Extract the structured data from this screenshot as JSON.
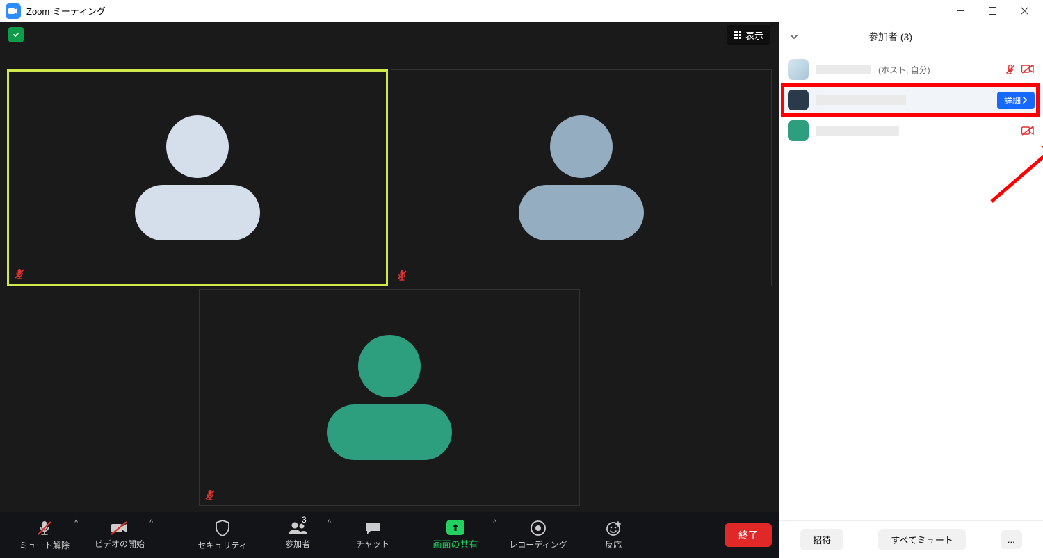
{
  "title_bar": {
    "title": "Zoom ミーティング"
  },
  "video_area": {
    "view_button": "表示",
    "tiles": [
      {
        "avatar_color": "#d5deeb",
        "muted": true,
        "highlighted": true
      },
      {
        "avatar_color": "#94adc1",
        "muted": true,
        "highlighted": false
      },
      {
        "avatar_color": "#2d9f7f",
        "muted": true,
        "highlighted": false
      }
    ]
  },
  "toolbar": {
    "mute": "ミュート解除",
    "video": "ビデオの開始",
    "security": "セキュリティ",
    "participants": "参加者",
    "participants_count": "3",
    "chat": "チャット",
    "share": "画面の共有",
    "record": "レコーディング",
    "reactions": "反応",
    "end": "終了"
  },
  "side": {
    "title": "参加者 (3)",
    "rows": [
      {
        "avatar_bg": "linear-gradient(135deg,#d8e8f0,#a8c4d8)",
        "role": "(ホスト, 自分)",
        "muted": true,
        "cam_off": true
      },
      {
        "avatar_bg": "#2a3a4a",
        "role": "",
        "hovered": true,
        "detail_btn": "詳細"
      },
      {
        "avatar_bg": "#2d9f7f",
        "role": "",
        "cam_off": true
      }
    ],
    "footer": {
      "invite": "招待",
      "mute_all": "すべてミュート",
      "more": "..."
    }
  }
}
